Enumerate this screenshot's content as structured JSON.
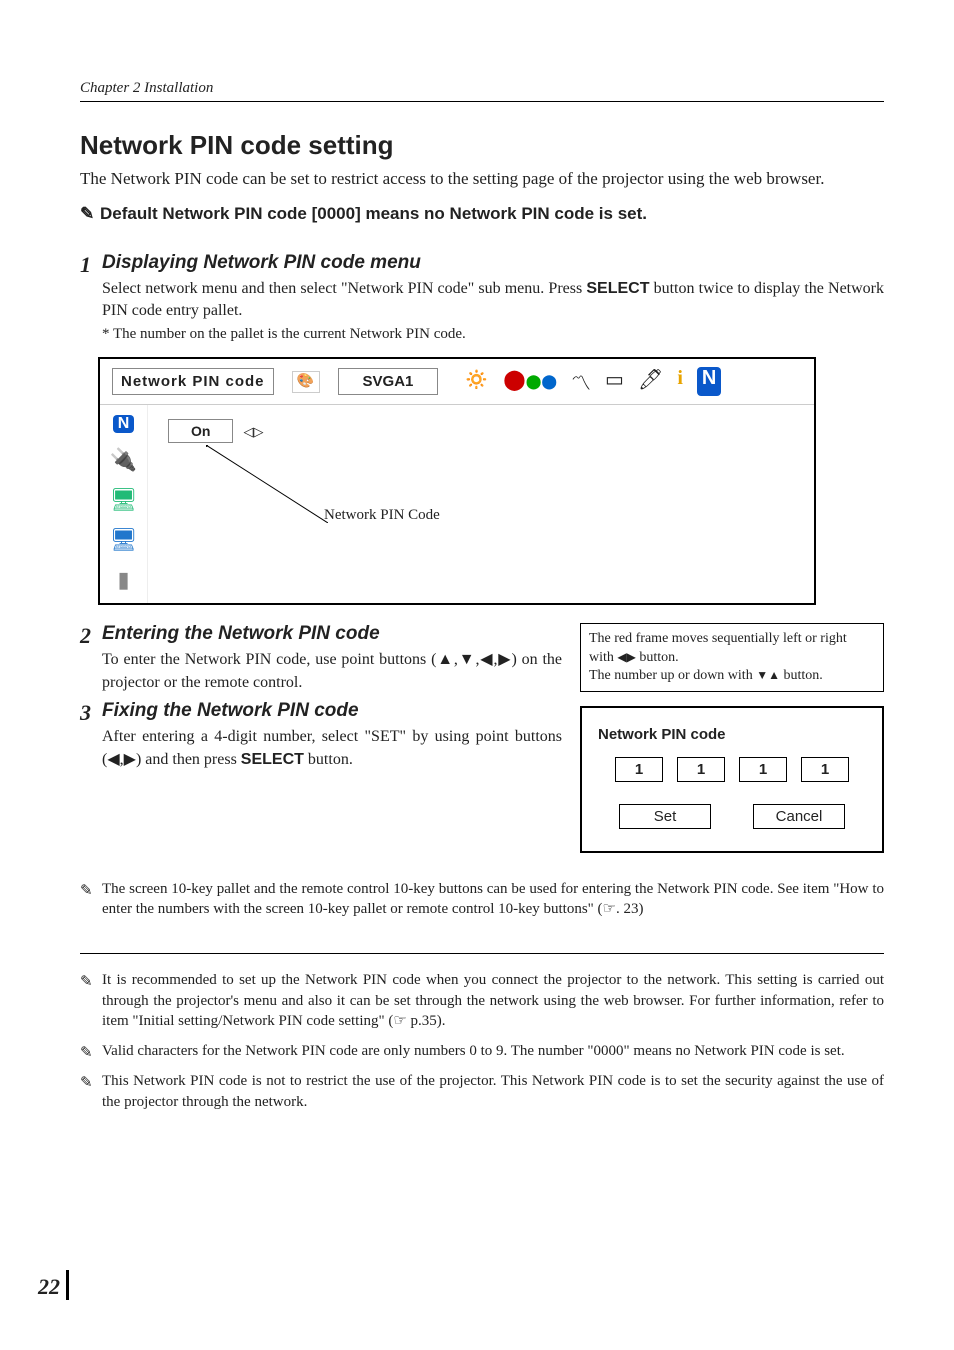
{
  "running_head": "Chapter 2 Installation",
  "h2": "Network PIN code setting",
  "lead": "The Network PIN code can be set to restrict access to the setting page of the projector using the web browser.",
  "default_note": "Default Network PIN code [0000] means no Network PIN code is set.",
  "step1": {
    "num": "1",
    "title": "Displaying Network PIN code menu",
    "body_a": "Select network menu and then select \"Network PIN code\" sub menu. Press ",
    "body_b": " button twice to display the Network PIN code entry pallet.",
    "select": "SELECT",
    "star": "* The number on the pallet is the current Network PIN code."
  },
  "osd": {
    "label": "Network PIN code",
    "svga": "SVGA1",
    "on": "On",
    "callout": "Network PIN Code"
  },
  "hint": {
    "line1": "The red frame moves sequentially left or right with",
    "line1b": "button.",
    "line2": "The number up or down with",
    "line2b": "button."
  },
  "step2": {
    "num": "2",
    "title": "Entering the Network PIN code",
    "body": "To enter the Network PIN code, use point buttons (▲,▼,◀,▶) on the  projector or the remote control."
  },
  "step3": {
    "num": "3",
    "title": "Fixing the Network PIN code",
    "body_a": "After entering a 4-digit number, select \"SET\" by using point buttons (◀,▶) and then press ",
    "body_b": " button.",
    "select": "SELECT"
  },
  "pin": {
    "title": "Network PIN code",
    "d1": "1",
    "d2": "1",
    "d3": "1",
    "d4": "1",
    "set": "Set",
    "cancel": "Cancel"
  },
  "note_a": "The screen 10-key pallet and the remote control 10-key buttons can be used for entering the Network PIN code. See item \"How to enter the numbers with the screen 10-key pallet or remote control 10-key buttons\" (☞. 23)",
  "foot1": "It is recommended to set up the Network PIN code when you connect the projector to the network. This setting is carried out through the projector's menu and also it can be set through the network using the web browser. For further information, refer to item \"Initial setting/Network PIN code setting\" (☞ p.35).",
  "foot2": "Valid characters for the Network PIN code are only numbers 0 to 9. The number \"0000\" means no Network PIN code is set.",
  "foot3": "This Network PIN code is not to restrict the use of the projector. This Network PIN code is to set the security against the use of the projector through the network.",
  "page_num": "22"
}
